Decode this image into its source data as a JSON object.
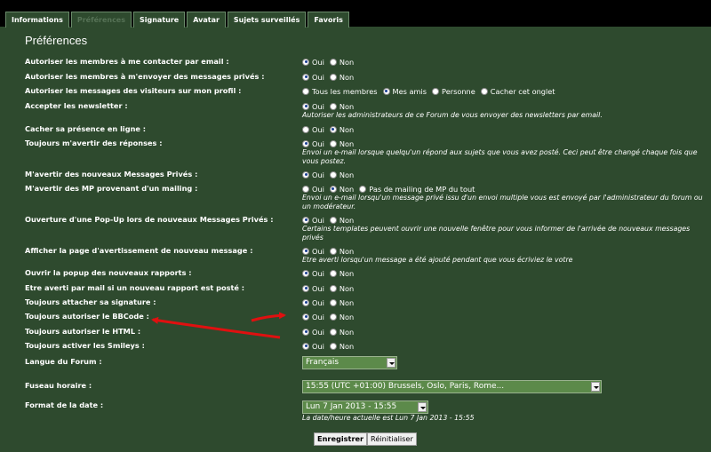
{
  "tabs": [
    {
      "label": "Informations",
      "active": false
    },
    {
      "label": "Préférences",
      "active": true
    },
    {
      "label": "Signature",
      "active": false
    },
    {
      "label": "Avatar",
      "active": false
    },
    {
      "label": "Sujets surveillés",
      "active": false
    },
    {
      "label": "Favoris",
      "active": false
    }
  ],
  "title": "Préférences",
  "yes": "Oui",
  "no": "Non",
  "rows": {
    "contact_email": {
      "label": "Autoriser les membres à me contacter par email :",
      "selected": "Oui"
    },
    "private_msgs": {
      "label": "Autoriser les membres à m'envoyer des messages privés :",
      "selected": "Oui"
    },
    "visitor_msgs": {
      "label": "Autoriser les messages des visiteurs sur mon profil :",
      "options": [
        "Tous les membres",
        "Mes amis",
        "Personne",
        "Cacher cet onglet"
      ],
      "selected": "Mes amis"
    },
    "newsletter": {
      "label": "Accepter les newsletter :",
      "selected": "Oui",
      "desc": "Autoriser les administrateurs de ce Forum de vous envoyer des newsletters par email."
    },
    "hide_online": {
      "label": "Cacher sa présence en ligne :",
      "selected": "Non"
    },
    "notify_replies": {
      "label": "Toujours m'avertir des réponses :",
      "selected": "Oui",
      "desc": "Envoi un e-mail lorsque quelqu'un répond aux sujets que vous avez posté. Ceci peut être changé chaque fois que vous postez."
    },
    "notify_pm": {
      "label": "M'avertir des nouveaux Messages Privés :",
      "selected": "Oui"
    },
    "notify_mailing": {
      "label": "M'avertir des MP provenant d'un mailing :",
      "options": [
        "Oui",
        "Non",
        "Pas de mailing de MP du tout"
      ],
      "selected": "Non",
      "desc": "Envoi un e-mail lorsqu'un message privé issu d'un envoi multiple vous est envoyé par l'administrateur du forum ou un modérateur."
    },
    "popup_pm": {
      "label": "Ouverture d'une Pop-Up lors de nouveaux Messages Privés :",
      "selected": "Oui",
      "desc": "Certains templates peuvent ouvrir une nouvelle fenêtre pour vous informer de l'arrivée de nouveaux messages privés"
    },
    "warning_page": {
      "label": "Afficher la page d'avertissement de nouveau message :",
      "selected": "Oui",
      "desc": "Etre averti lorsqu'un message a été ajouté pendant que vous écriviez le votre"
    },
    "popup_reports": {
      "label": "Ouvrir la popup des nouveaux rapports :",
      "selected": "Oui"
    },
    "mail_reports": {
      "label": "Etre averti par mail si un nouveau rapport est posté :",
      "selected": "Oui"
    },
    "attach_sig": {
      "label": "Toujours attacher sa signature :",
      "selected": "Oui"
    },
    "bbcode": {
      "label": "Toujours autoriser le BBCode :",
      "selected": "Oui"
    },
    "html": {
      "label": "Toujours autoriser le HTML :",
      "selected": "Oui"
    },
    "smileys": {
      "label": "Toujours activer les Smileys :",
      "selected": "Oui"
    }
  },
  "language": {
    "label": "Langue du Forum :",
    "value": "Français"
  },
  "timezone": {
    "label": "Fuseau horaire :",
    "value": "15:55 (UTC +01:00) Brussels, Oslo, Paris, Rome..."
  },
  "date_format": {
    "label": "Format de la date :",
    "value": "Lun 7 Jan 2013 - 15:55",
    "desc": "La date/heure actuelle est Lun 7 Jan 2013 - 15:55"
  },
  "buttons": {
    "save": "Enregistrer",
    "reset": "Réinitialiser"
  },
  "colors": {
    "background": "#2e4a2e",
    "topbar": "#000000",
    "annotation_arrow": "#e01010",
    "select_bg": "#5c8a4a"
  }
}
